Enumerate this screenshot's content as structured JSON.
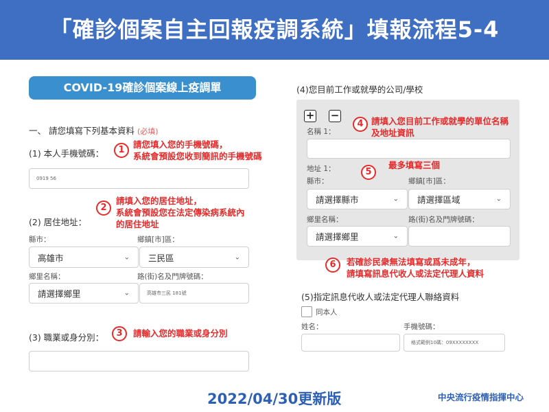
{
  "banner": {
    "title": "「確診個案自主回報疫調系統」填報流程5-4"
  },
  "form_title": "COVID-19確診個案線上疫調單",
  "section1": {
    "heading": "一、 請您填寫下列基本資料",
    "required": "(必填)"
  },
  "phone": {
    "label": "(1) 本人手機號碼：",
    "value": "0919    56"
  },
  "address": {
    "label": "(2) 居住地址：",
    "county_label": "縣市：",
    "county_value": "高雄市",
    "district_label": "鄉鎮[市]區：",
    "district_value": "三民區",
    "village_label": "鄉里名稱：",
    "village_value": "請選擇鄉里",
    "street_label": "路(街)名及門牌號碼：",
    "street_value": "高雄市三民        181號"
  },
  "occupation": {
    "label": "(3) 職業或身分別："
  },
  "workplace": {
    "label": "(4)您目前工作或就學的公司/學校",
    "plus": "+",
    "minus": "−",
    "name_label": "名稱 1：",
    "address_label": "地址 1：",
    "county_label": "縣市：",
    "county_value": "請選擇縣市",
    "district_label": "鄉鎮[市]區：",
    "district_value": "請選擇區域",
    "village_label": "鄉里名稱：",
    "village_value": "請選擇鄉里",
    "street_label": "路(街)名及門牌號碼："
  },
  "proxy": {
    "label": "(5)指定訊息代收人或法定代理人聯絡資料",
    "same_label": "同本人",
    "name_label": "姓名：",
    "phone_label": "手機號碼：",
    "phone_placeholder": "格式範例10碼：09XXXXXXXX"
  },
  "annotations": {
    "n1": "1",
    "t1a": "請您填入您的手機號碼，",
    "t1b": "系統會預設您收到簡訊的手機號碼",
    "n2": "2",
    "t2a": "請填入您的居住地址，",
    "t2b": "系統會預設您在法定傳染病系統內",
    "t2c": "的居住地址",
    "n3": "3",
    "t3": "請輸入您的職業或身分別",
    "n4": "4",
    "t4a": "請填入您目前工作或就學的單位名稱",
    "t4b": "及地址資訊",
    "n5": "5",
    "t5": "最多填寫三個",
    "n6": "6",
    "t6a": "若確診民衆無法填寫或爲未成年，",
    "t6b": "請填寫訊息代收人或法定代理人資料"
  },
  "footer": {
    "date": "2022/04/30更新版",
    "org": "中央流行疫情指揮中心"
  },
  "icons": {
    "chevron": "chevron-down-icon"
  },
  "colors": {
    "banner": "#3f6fc2",
    "accent_red": "#e52b2b",
    "pill": "#3a8fcf"
  }
}
